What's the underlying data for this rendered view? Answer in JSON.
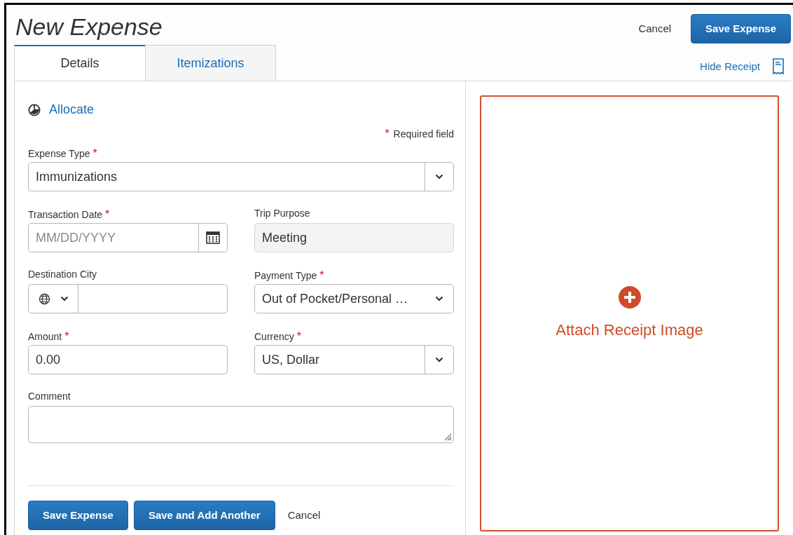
{
  "title": "New Expense",
  "header_actions": [
    {
      "label": "Cancel",
      "kind": "link"
    },
    {
      "label": "Save Expense",
      "kind": "primary"
    }
  ],
  "tabs": [
    {
      "label": "Details",
      "selected": true
    },
    {
      "label": "Itemizations",
      "selected": false
    }
  ],
  "hide_receipt": "Hide Receipt",
  "allocate": "Allocate",
  "required_mark": "*",
  "required_note": "Required field",
  "field_rows": [
    [
      {
        "kind": "select",
        "label": "Expense Type",
        "required": true,
        "value": "Immunizations"
      }
    ],
    [
      {
        "kind": "date",
        "label": "Transaction Date",
        "required": true,
        "placeholder": "MM/DD/YYYY"
      },
      {
        "kind": "readonly",
        "label": "Trip Purpose",
        "required": false,
        "value": "Meeting"
      }
    ],
    [
      {
        "kind": "city",
        "label": "Destination City",
        "required": false
      },
      {
        "kind": "dropdown",
        "label": "Payment Type",
        "required": true,
        "value": "Out of Pocket/Personal …"
      }
    ],
    [
      {
        "kind": "text",
        "label": "Amount",
        "required": true,
        "value": "0.00"
      },
      {
        "kind": "select",
        "label": "Currency",
        "required": true,
        "value": "US, Dollar"
      }
    ],
    [
      {
        "kind": "textarea",
        "label": "Comment",
        "required": false
      }
    ]
  ],
  "footer_buttons": [
    {
      "label": "Save Expense",
      "kind": "primary"
    },
    {
      "label": "Save and Add Another",
      "kind": "primary"
    },
    {
      "label": "Cancel",
      "kind": "link"
    }
  ],
  "attach_receipt": "Attach Receipt Image"
}
